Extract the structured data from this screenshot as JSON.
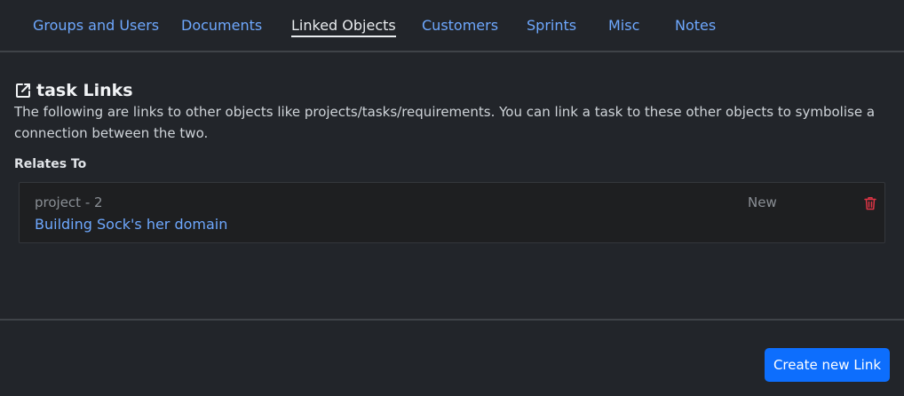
{
  "tabs": [
    {
      "label": "Groups and Users",
      "active": false
    },
    {
      "label": "Documents",
      "active": false
    },
    {
      "label": "Linked Objects",
      "active": true
    },
    {
      "label": "Customers",
      "active": false
    },
    {
      "label": "Sprints",
      "active": false
    },
    {
      "label": "Misc",
      "active": false
    },
    {
      "label": "Notes",
      "active": false
    }
  ],
  "section": {
    "icon": "external-link-icon",
    "title": "task Links",
    "description": "The following are links to other objects like projects/tasks/requirements. You can link a task to these other objects to symbolise a connection between the two."
  },
  "relations": {
    "label": "Relates To",
    "items": [
      {
        "type": "project - 2",
        "title": "Building Sock's her domain",
        "status": "New",
        "delete_icon": "trash-icon"
      }
    ]
  },
  "footer": {
    "create_label": "Create new Link"
  },
  "colors": {
    "background": "#22252a",
    "link": "#6ea8fe",
    "primary": "#0d6efd",
    "danger": "#dc3545",
    "card": "#1e1f21"
  }
}
